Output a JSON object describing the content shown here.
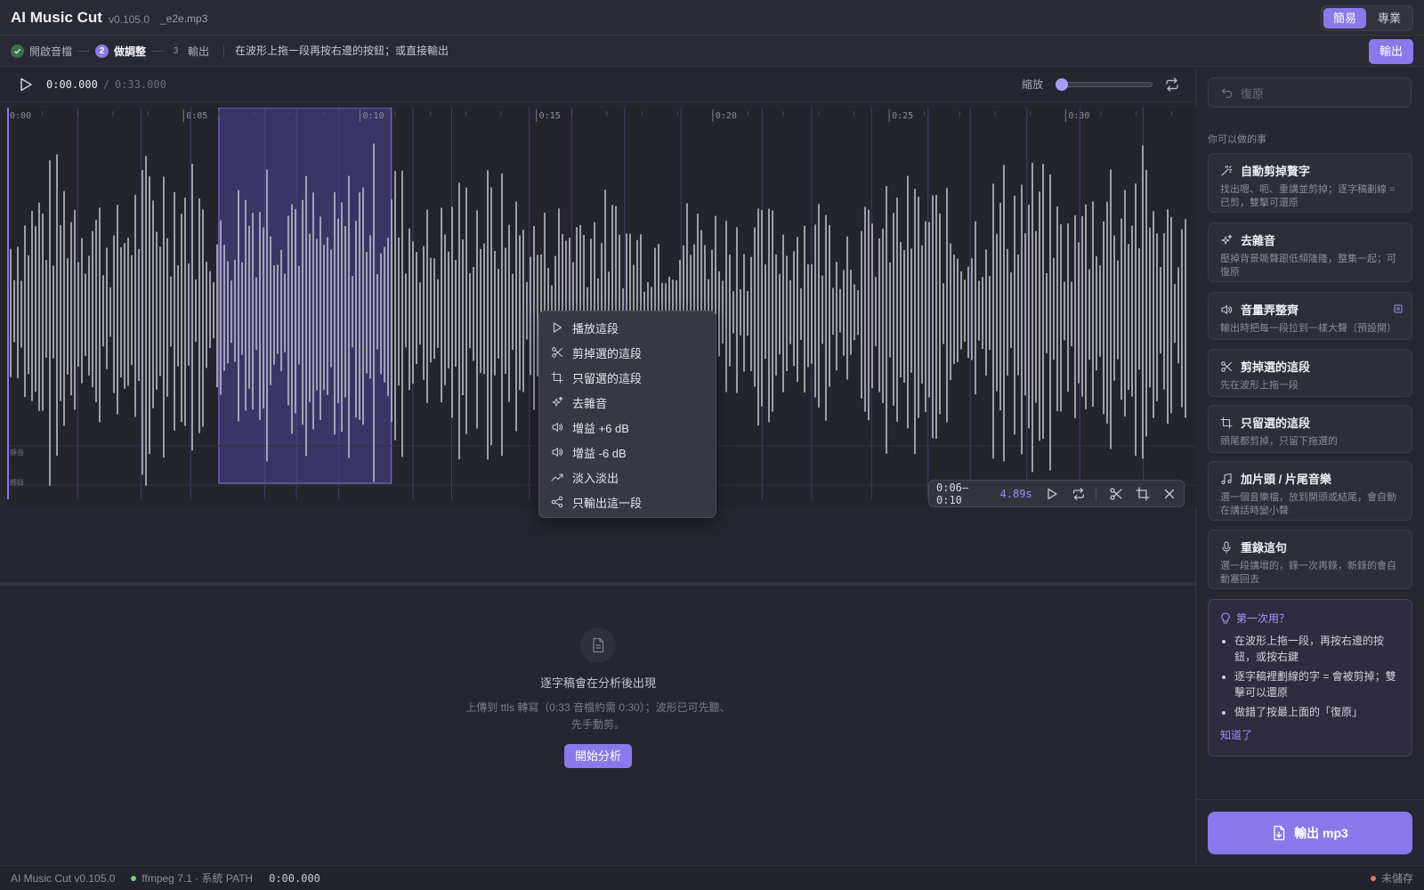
{
  "app": {
    "name": "AI Music Cut",
    "version": "v0.105.0",
    "file": "_e2e.mp3"
  },
  "modes": {
    "simple": "簡易",
    "pro": "專業",
    "active": "simple"
  },
  "steps": [
    {
      "num": "✓",
      "label": "開啟音檔",
      "state": "done"
    },
    {
      "num": "2",
      "label": "做調整",
      "state": "current"
    },
    {
      "num": "3",
      "label": "輸出",
      "state": "todo"
    }
  ],
  "step_hint": "在波形上拖一段再按右邊的按鈕；或直接輸出",
  "export_top": "輸出",
  "transport": {
    "current": "0:00.000",
    "separator": "/",
    "total": "0:33.000",
    "zoom_label": "縮放",
    "zoom_level": 0
  },
  "ruler": [
    "0:00",
    "0:05",
    "0:10",
    "0:15",
    "0:20",
    "0:25",
    "0:30"
  ],
  "lanes": [
    "靜音",
    "轉錄"
  ],
  "selection": {
    "range": "0:06–0:10",
    "duration": "4.89s"
  },
  "context_menu": [
    {
      "icon": "play-icon",
      "label": "播放這段"
    },
    {
      "icon": "scissors-icon",
      "label": "剪掉選的這段"
    },
    {
      "icon": "crop-icon",
      "label": "只留選的這段"
    },
    {
      "icon": "sparkle-icon",
      "label": "去雜音"
    },
    {
      "icon": "volume-icon",
      "label": "增益 +6 dB"
    },
    {
      "icon": "volume-icon",
      "label": "增益 -6 dB"
    },
    {
      "icon": "trend-icon",
      "label": "淡入淡出"
    },
    {
      "icon": "share-icon",
      "label": "只輸出這一段"
    }
  ],
  "empty_state": {
    "title": "逐字稿會在分析後出現",
    "sub_line1": "上傳到 ttls 轉寫（0:33 音檔約需 0:30）；波形已可先聽、",
    "sub_line2": "先手動剪。",
    "button": "開始分析"
  },
  "sidebar": {
    "undo": "復原",
    "section_title": "你可以做的事",
    "cards": [
      {
        "icon": "wand-icon",
        "title": "自動剪掉贅字",
        "desc": "找出嗯、呃、重講並剪掉；逐字稿劃線 = 已剪，雙擊可還原"
      },
      {
        "icon": "sparkle-icon",
        "title": "去雜音",
        "desc": "壓掉背景嘶聲跟低頻隆隆，整集一起；可復原"
      },
      {
        "icon": "volume-icon",
        "title": "音量弄整齊",
        "desc": "輸出時把每一段拉到一樣大聲（預設開）"
      },
      {
        "icon": "scissors-icon",
        "title": "剪掉選的這段",
        "desc": "先在波形上拖一段"
      },
      {
        "icon": "crop-icon",
        "title": "只留選的這段",
        "desc": "頭尾都剪掉，只留下拖選的"
      },
      {
        "icon": "music-icon",
        "title": "加片頭 / 片尾音樂",
        "desc": "選一個音樂檔，放到開頭或結尾，會自動在講話時變小聲"
      },
      {
        "icon": "mic-icon",
        "title": "重錄這句",
        "desc": "選一段講壞的，錄一次再錄，新錄的會自動塞回去"
      }
    ],
    "tips": {
      "title": "第一次用？",
      "items": [
        "在波形上拖一段，再按右邊的按鈕，或按右鍵",
        "逐字稿裡劃線的字 = 會被剪掉；雙擊可以還原",
        "做錯了按最上面的「復原」"
      ],
      "link": "知道了"
    },
    "export_button": "輸出 mp3"
  },
  "status": {
    "app": "AI Music Cut v0.105.0",
    "ffmpeg": "ffmpeg 7.1 · 系統 PATH",
    "time": "0:00.000",
    "saved": "未儲存"
  },
  "colors": {
    "accent": "#8b78ea",
    "ok": "#5fd38a",
    "warn": "#e5735c"
  }
}
